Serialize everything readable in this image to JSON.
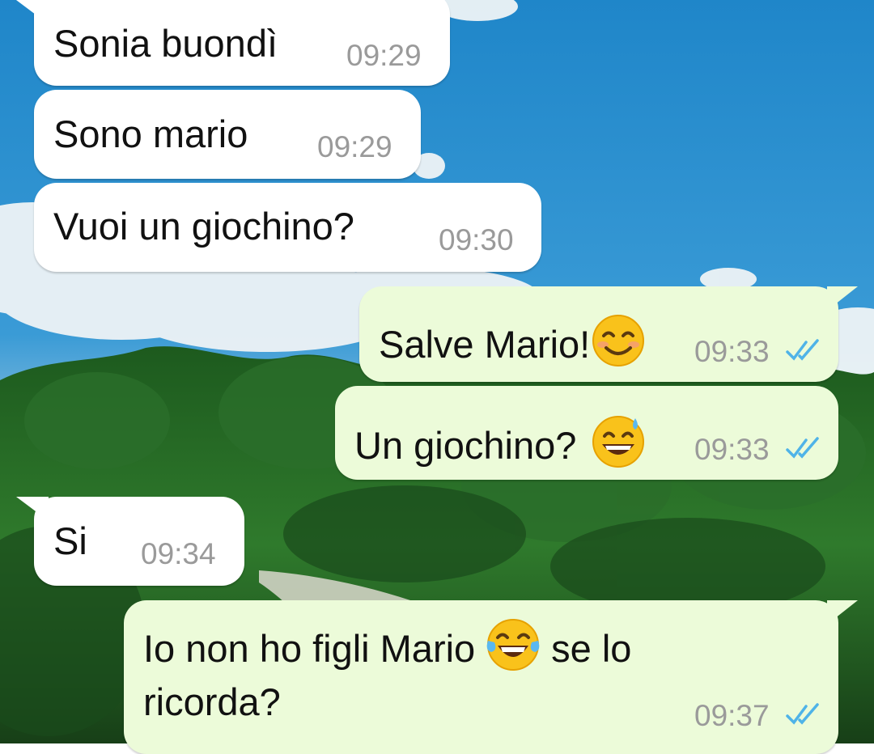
{
  "chat": {
    "messages": [
      {
        "direction": "incoming",
        "text": "Sonia buondì",
        "time": "09:29"
      },
      {
        "direction": "incoming",
        "text": "Sono mario",
        "time": "09:29"
      },
      {
        "direction": "incoming",
        "text": "Vuoi un giochino?",
        "time": "09:30"
      },
      {
        "direction": "outgoing",
        "text": "Salve Mario!",
        "emoji": "smiling-face-emoji",
        "time": "09:33",
        "status": "read-double-check"
      },
      {
        "direction": "outgoing",
        "text": "Un giochino? ",
        "emoji": "grinning-sweat-emoji",
        "time": "09:33",
        "status": "read-double-check"
      },
      {
        "direction": "incoming",
        "text": "Si",
        "time": "09:34"
      },
      {
        "direction": "outgoing",
        "text_before_emoji": "Io non ho figli Mario",
        "emoji": "tears-of-joy-emoji",
        "text_after_emoji": "se lo",
        "text_line2": "ricorda?",
        "time": "09:37",
        "status": "read-double-check"
      }
    ]
  },
  "colors": {
    "incoming_bubble": "#ffffff",
    "outgoing_bubble": "#ecfbd9",
    "timestamp": "#9a9a9a",
    "read_tick": "#4fb3e8"
  },
  "background": {
    "description_icon": "sky-and-forest-wallpaper"
  }
}
